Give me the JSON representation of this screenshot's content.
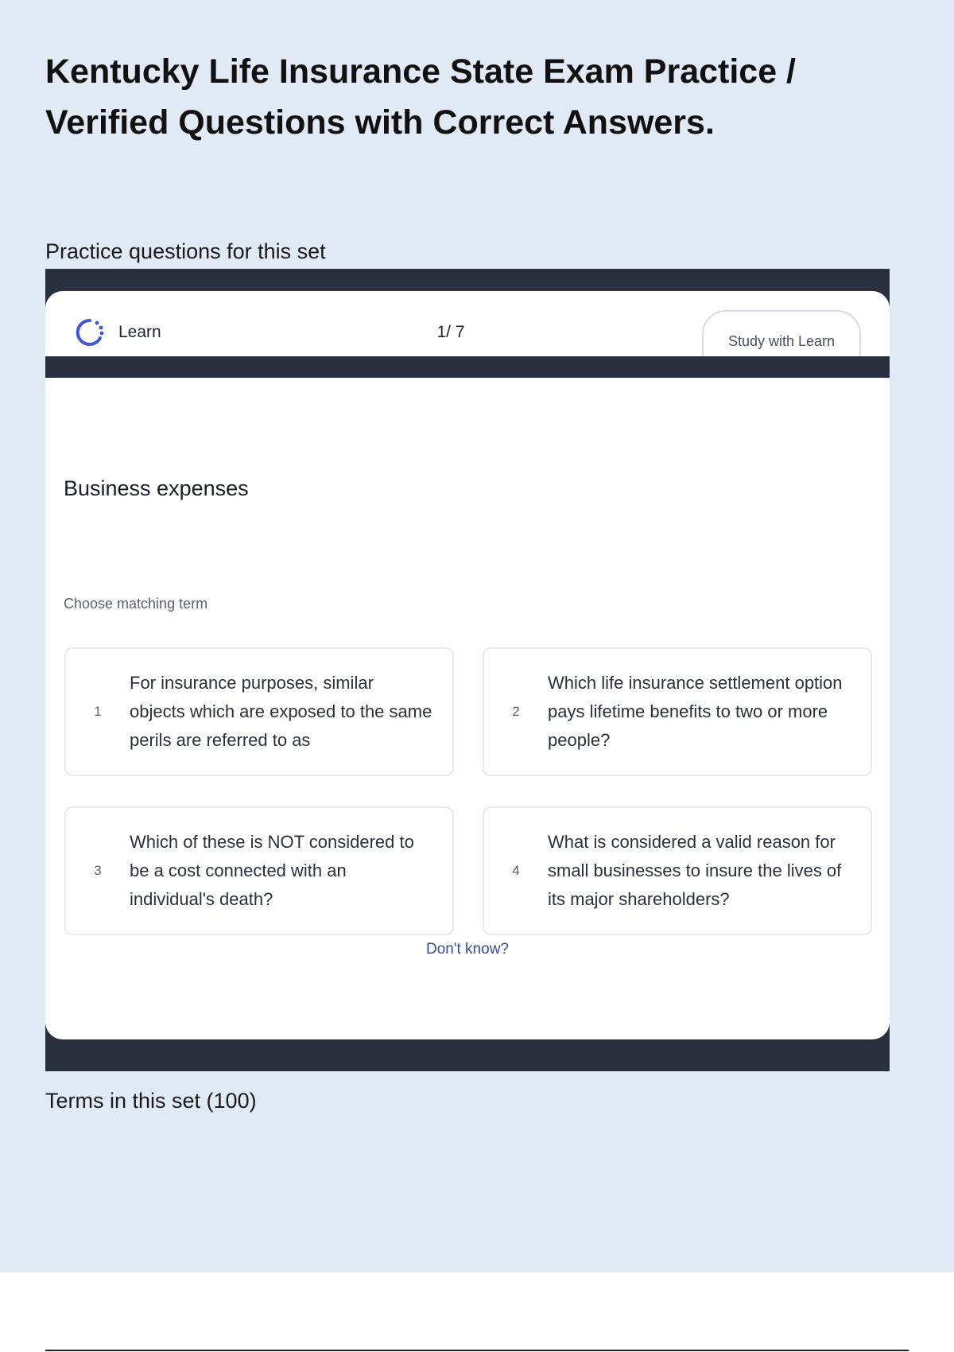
{
  "page": {
    "title": "Kentucky Life Insurance State Exam Practice / Verified Questions with Correct Answers.",
    "practice_label": "Practice questions for this set",
    "terms_label": "Terms in this set (100)"
  },
  "learn_widget": {
    "mode_label": "Learn",
    "counter": "1/ 7",
    "study_button": "Study with Learn",
    "prompt": "Business expenses",
    "instruction": "Choose matching term",
    "options": [
      {
        "number": "1",
        "text": "For insurance purposes, similar objects which are exposed to the same perils are referred to as"
      },
      {
        "number": "2",
        "text": "Which life insurance settlement option pays lifetime benefits to two or more people?"
      },
      {
        "number": "3",
        "text": "Which of these is NOT considered to be a cost connected with an individual's death?"
      },
      {
        "number": "4",
        "text": "What is considered a valid reason for small businesses to insure the lives of its major shareholders?"
      }
    ],
    "dont_know": "Don't know?"
  },
  "colors": {
    "page_background": "#e1e9f4",
    "frame_dark": "#2a2f3e",
    "accent_icon": "#4257d6",
    "link": "#3a4d8f"
  },
  "icons": {
    "learn": "learn-progress-icon"
  }
}
